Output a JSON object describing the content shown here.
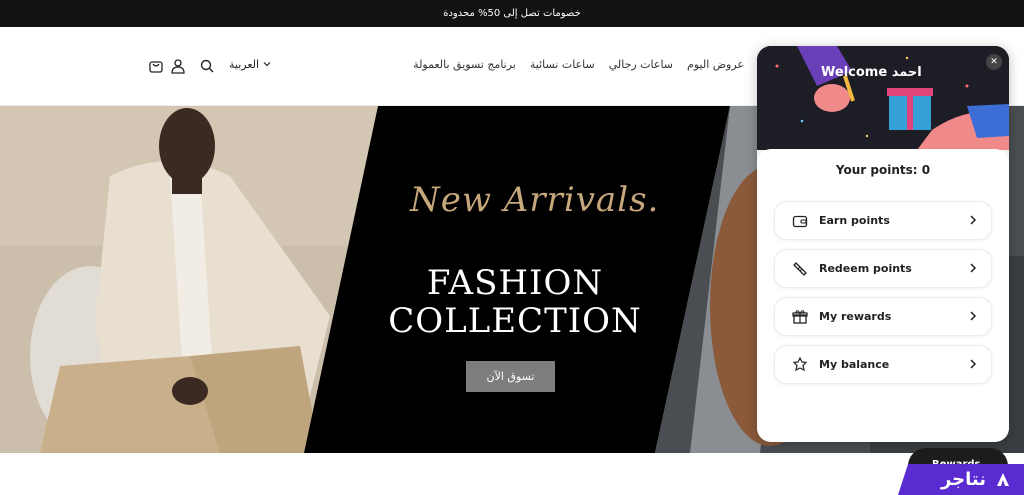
{
  "announcement": "خصومات تصل إلى 50% محدودة",
  "header": {
    "language": "العربية",
    "nav": [
      "عروض اليوم",
      "ساعات رجالي",
      "ساعات نسائية",
      "برنامج تسويق بالعمولة"
    ],
    "icons": [
      "cart-icon",
      "account-icon",
      "search-icon",
      "chevron-down-icon"
    ]
  },
  "hero": {
    "script_text": "New Arrivals.",
    "headline_line1": "FASHION",
    "headline_line2": "COLLECTION",
    "cta_label": "تسوق الآن"
  },
  "popup": {
    "welcome": "Welcome احمد",
    "points_label": "Your points: 0",
    "items": [
      {
        "label": "Earn points",
        "icon": "wallet-icon"
      },
      {
        "label": "Redeem points",
        "icon": "ticket-icon"
      },
      {
        "label": "My rewards",
        "icon": "gift-icon"
      },
      {
        "label": "My balance",
        "icon": "coins-icon"
      }
    ]
  },
  "rewards_button": "Rewards",
  "brand": {
    "name": "نتاجر",
    "color": "#5a2bd1"
  }
}
